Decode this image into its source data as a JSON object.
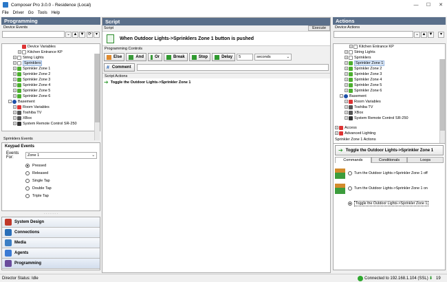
{
  "window": {
    "title": "Composer Pro 3.0.0 - Residence (Local)",
    "min": "—",
    "max": "☐",
    "close": "✕"
  },
  "menu": [
    "File",
    "Driver",
    "Go",
    "Tools",
    "Help"
  ],
  "left": {
    "header": "Programming",
    "device_events_label": "Device Events",
    "tree": [
      {
        "label": "Device Variables",
        "indent": 3,
        "icon": "red",
        "exp": ""
      },
      {
        "label": "Kitchen Entrance KP",
        "indent": 3,
        "icon": "doc",
        "exp": "+"
      },
      {
        "label": "String Lights",
        "indent": 2,
        "icon": "doc",
        "exp": "+"
      },
      {
        "label": "Sprinklers",
        "indent": 2,
        "icon": "doc",
        "exp": "+",
        "selected": true
      },
      {
        "label": "Sprinkler Zone 1",
        "indent": 2,
        "icon": "green",
        "exp": "+"
      },
      {
        "label": "Sprinkler Zone 2",
        "indent": 2,
        "icon": "green",
        "exp": "+"
      },
      {
        "label": "Sprinkler Zone 3",
        "indent": 2,
        "icon": "green",
        "exp": "+"
      },
      {
        "label": "Sprinkler Zone 4",
        "indent": 2,
        "icon": "green",
        "exp": "+"
      },
      {
        "label": "Sprinkler Zone 5",
        "indent": 2,
        "icon": "green",
        "exp": "+"
      },
      {
        "label": "Sprinkler Zone 6",
        "indent": 2,
        "icon": "green",
        "exp": "+"
      },
      {
        "label": "Basement",
        "indent": 1,
        "icon": "blue",
        "exp": "-"
      },
      {
        "label": "Room Variables",
        "indent": 2,
        "icon": "red",
        "exp": "+"
      },
      {
        "label": "Toshiba TV",
        "indent": 2,
        "icon": "tv",
        "exp": "+"
      },
      {
        "label": "XBox",
        "indent": 2,
        "icon": "tv",
        "exp": "+"
      },
      {
        "label": "System Remote Control SR-250",
        "indent": 2,
        "icon": "remote",
        "exp": "+"
      }
    ],
    "events_panel_label": "Sprinklers Events",
    "keypad_events": "Keypad Events",
    "events_for_label": "Events For:",
    "events_for_value": "Zone 1",
    "radios": [
      {
        "label": "Pressed",
        "checked": true
      },
      {
        "label": "Released"
      },
      {
        "label": "Single Tap"
      },
      {
        "label": "Double Tap"
      },
      {
        "label": "Triple Tap"
      }
    ],
    "nav": [
      "System Design",
      "Connections",
      "Media",
      "Agents",
      "Programming"
    ]
  },
  "center": {
    "header": "Script",
    "script_label": "Script",
    "execute": "Execute",
    "event_title": "When Outdoor Lights->Sprinklers Zone 1 button is pushed",
    "controls_label": "Programming Controls",
    "controls": [
      "Else",
      "And",
      "Or",
      "Break",
      "Stop",
      "Delay"
    ],
    "delay_value": "5",
    "delay_unit": "seconds",
    "comment": "Comment",
    "actions_label": "Script Actions",
    "action": "Toggle the Outdoor Lights->Sprinkler Zone 1"
  },
  "right": {
    "header": "Actions",
    "device_actions_label": "Device Actions",
    "tree": [
      {
        "label": "Kitchen Entrance KP",
        "indent": 3,
        "icon": "doc",
        "exp": "+"
      },
      {
        "label": "String Lights",
        "indent": 2,
        "icon": "doc",
        "exp": "+"
      },
      {
        "label": "Sprinklers",
        "indent": 2,
        "icon": "doc",
        "exp": "+"
      },
      {
        "label": "Sprinkler Zone 1",
        "indent": 2,
        "icon": "green",
        "exp": "+",
        "selected": true
      },
      {
        "label": "Sprinkler Zone 2",
        "indent": 2,
        "icon": "green",
        "exp": "+"
      },
      {
        "label": "Sprinkler Zone 3",
        "indent": 2,
        "icon": "green",
        "exp": "+"
      },
      {
        "label": "Sprinkler Zone 4",
        "indent": 2,
        "icon": "green",
        "exp": "+"
      },
      {
        "label": "Sprinkler Zone 5",
        "indent": 2,
        "icon": "green",
        "exp": "+"
      },
      {
        "label": "Sprinkler Zone 6",
        "indent": 2,
        "icon": "green",
        "exp": "+"
      },
      {
        "label": "Basement",
        "indent": 1,
        "icon": "blue",
        "exp": "-"
      },
      {
        "label": "Room Variables",
        "indent": 2,
        "icon": "red",
        "exp": "+"
      },
      {
        "label": "Toshiba TV",
        "indent": 2,
        "icon": "tv",
        "exp": "+"
      },
      {
        "label": "XBox",
        "indent": 2,
        "icon": "tv",
        "exp": "+"
      },
      {
        "label": "System Remote Control SR-250",
        "indent": 2,
        "icon": "remote",
        "exp": "+"
      }
    ],
    "tree_bottom": [
      {
        "label": "Access",
        "indent": 0,
        "icon": "red",
        "exp": "+"
      },
      {
        "label": "Advanced Lighting",
        "indent": 0,
        "icon": "red",
        "exp": "+"
      }
    ],
    "zone_actions_label": "Sprinkler Zone 1 Actions",
    "zone_action_title": "Toggle the Outdoor Lights->Sprinkler Zone 1",
    "tabs": [
      "Commands",
      "Conditionals",
      "Loops"
    ],
    "commands": [
      {
        "label": "Turn the Outdoor Lights->Sprinkler Zone 1 off"
      },
      {
        "label": "Turn the Outdoor Lights->Sprinkler Zone 1 on"
      },
      {
        "label": "Toggle the Outdoor Lights->Sprinkler Zone 1",
        "checked": true
      }
    ]
  },
  "status": {
    "left": "Director Status: Idle",
    "connected": "Connected to 192.168.1.104 (SSL)",
    "count": "19"
  }
}
